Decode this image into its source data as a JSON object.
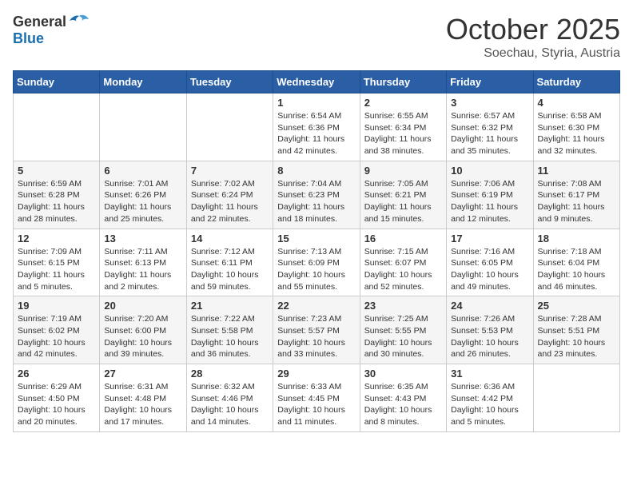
{
  "header": {
    "logo_general": "General",
    "logo_blue": "Blue",
    "month": "October 2025",
    "location": "Soechau, Styria, Austria"
  },
  "days_of_week": [
    "Sunday",
    "Monday",
    "Tuesday",
    "Wednesday",
    "Thursday",
    "Friday",
    "Saturday"
  ],
  "weeks": [
    [
      {
        "day": "",
        "info": ""
      },
      {
        "day": "",
        "info": ""
      },
      {
        "day": "",
        "info": ""
      },
      {
        "day": "1",
        "info": "Sunrise: 6:54 AM\nSunset: 6:36 PM\nDaylight: 11 hours\nand 42 minutes."
      },
      {
        "day": "2",
        "info": "Sunrise: 6:55 AM\nSunset: 6:34 PM\nDaylight: 11 hours\nand 38 minutes."
      },
      {
        "day": "3",
        "info": "Sunrise: 6:57 AM\nSunset: 6:32 PM\nDaylight: 11 hours\nand 35 minutes."
      },
      {
        "day": "4",
        "info": "Sunrise: 6:58 AM\nSunset: 6:30 PM\nDaylight: 11 hours\nand 32 minutes."
      }
    ],
    [
      {
        "day": "5",
        "info": "Sunrise: 6:59 AM\nSunset: 6:28 PM\nDaylight: 11 hours\nand 28 minutes."
      },
      {
        "day": "6",
        "info": "Sunrise: 7:01 AM\nSunset: 6:26 PM\nDaylight: 11 hours\nand 25 minutes."
      },
      {
        "day": "7",
        "info": "Sunrise: 7:02 AM\nSunset: 6:24 PM\nDaylight: 11 hours\nand 22 minutes."
      },
      {
        "day": "8",
        "info": "Sunrise: 7:04 AM\nSunset: 6:23 PM\nDaylight: 11 hours\nand 18 minutes."
      },
      {
        "day": "9",
        "info": "Sunrise: 7:05 AM\nSunset: 6:21 PM\nDaylight: 11 hours\nand 15 minutes."
      },
      {
        "day": "10",
        "info": "Sunrise: 7:06 AM\nSunset: 6:19 PM\nDaylight: 11 hours\nand 12 minutes."
      },
      {
        "day": "11",
        "info": "Sunrise: 7:08 AM\nSunset: 6:17 PM\nDaylight: 11 hours\nand 9 minutes."
      }
    ],
    [
      {
        "day": "12",
        "info": "Sunrise: 7:09 AM\nSunset: 6:15 PM\nDaylight: 11 hours\nand 5 minutes."
      },
      {
        "day": "13",
        "info": "Sunrise: 7:11 AM\nSunset: 6:13 PM\nDaylight: 11 hours\nand 2 minutes."
      },
      {
        "day": "14",
        "info": "Sunrise: 7:12 AM\nSunset: 6:11 PM\nDaylight: 10 hours\nand 59 minutes."
      },
      {
        "day": "15",
        "info": "Sunrise: 7:13 AM\nSunset: 6:09 PM\nDaylight: 10 hours\nand 55 minutes."
      },
      {
        "day": "16",
        "info": "Sunrise: 7:15 AM\nSunset: 6:07 PM\nDaylight: 10 hours\nand 52 minutes."
      },
      {
        "day": "17",
        "info": "Sunrise: 7:16 AM\nSunset: 6:05 PM\nDaylight: 10 hours\nand 49 minutes."
      },
      {
        "day": "18",
        "info": "Sunrise: 7:18 AM\nSunset: 6:04 PM\nDaylight: 10 hours\nand 46 minutes."
      }
    ],
    [
      {
        "day": "19",
        "info": "Sunrise: 7:19 AM\nSunset: 6:02 PM\nDaylight: 10 hours\nand 42 minutes."
      },
      {
        "day": "20",
        "info": "Sunrise: 7:20 AM\nSunset: 6:00 PM\nDaylight: 10 hours\nand 39 minutes."
      },
      {
        "day": "21",
        "info": "Sunrise: 7:22 AM\nSunset: 5:58 PM\nDaylight: 10 hours\nand 36 minutes."
      },
      {
        "day": "22",
        "info": "Sunrise: 7:23 AM\nSunset: 5:57 PM\nDaylight: 10 hours\nand 33 minutes."
      },
      {
        "day": "23",
        "info": "Sunrise: 7:25 AM\nSunset: 5:55 PM\nDaylight: 10 hours\nand 30 minutes."
      },
      {
        "day": "24",
        "info": "Sunrise: 7:26 AM\nSunset: 5:53 PM\nDaylight: 10 hours\nand 26 minutes."
      },
      {
        "day": "25",
        "info": "Sunrise: 7:28 AM\nSunset: 5:51 PM\nDaylight: 10 hours\nand 23 minutes."
      }
    ],
    [
      {
        "day": "26",
        "info": "Sunrise: 6:29 AM\nSunset: 4:50 PM\nDaylight: 10 hours\nand 20 minutes."
      },
      {
        "day": "27",
        "info": "Sunrise: 6:31 AM\nSunset: 4:48 PM\nDaylight: 10 hours\nand 17 minutes."
      },
      {
        "day": "28",
        "info": "Sunrise: 6:32 AM\nSunset: 4:46 PM\nDaylight: 10 hours\nand 14 minutes."
      },
      {
        "day": "29",
        "info": "Sunrise: 6:33 AM\nSunset: 4:45 PM\nDaylight: 10 hours\nand 11 minutes."
      },
      {
        "day": "30",
        "info": "Sunrise: 6:35 AM\nSunset: 4:43 PM\nDaylight: 10 hours\nand 8 minutes."
      },
      {
        "day": "31",
        "info": "Sunrise: 6:36 AM\nSunset: 4:42 PM\nDaylight: 10 hours\nand 5 minutes."
      },
      {
        "day": "",
        "info": ""
      }
    ]
  ]
}
